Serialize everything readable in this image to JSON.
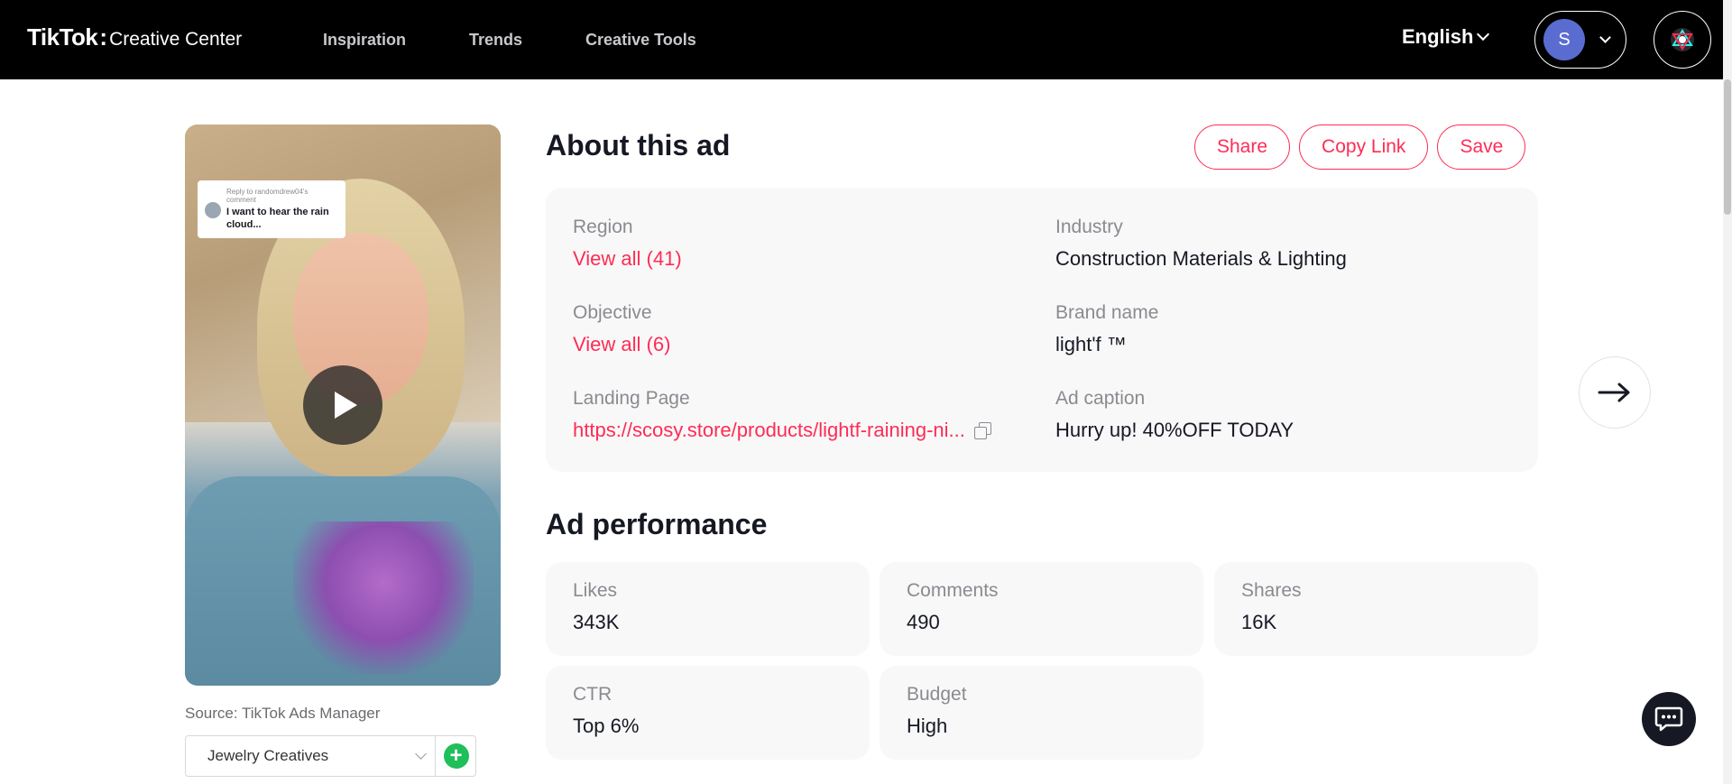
{
  "header": {
    "brand": "TikTok",
    "separator": ":",
    "product": "Creative Center",
    "nav": [
      "Inspiration",
      "Trends",
      "Creative Tools"
    ],
    "language": "English",
    "avatar_initial": "S"
  },
  "video": {
    "comment_reply": "Reply to randomdrew04's comment",
    "comment_text": "I want to hear the rain cloud..."
  },
  "source_label": "Source: TikTok Ads Manager",
  "collection": {
    "selected": "Jewelry Creatives",
    "add_symbol": "+"
  },
  "about": {
    "title": "About this ad",
    "actions": {
      "share": "Share",
      "copy_link": "Copy Link",
      "save": "Save"
    },
    "fields": {
      "region": {
        "label": "Region",
        "value": "View all (41)"
      },
      "industry": {
        "label": "Industry",
        "value": "Construction Materials & Lighting"
      },
      "objective": {
        "label": "Objective",
        "value": "View all (6)"
      },
      "brand_name": {
        "label": "Brand name",
        "value": "light'f ™"
      },
      "landing_page": {
        "label": "Landing Page",
        "value": "https://scosy.store/products/lightf-raining-ni..."
      },
      "ad_caption": {
        "label": "Ad caption",
        "value": "Hurry up! 40%OFF TODAY"
      }
    }
  },
  "performance": {
    "title": "Ad performance",
    "metrics": {
      "likes": {
        "label": "Likes",
        "value": "343K"
      },
      "comments": {
        "label": "Comments",
        "value": "490"
      },
      "shares": {
        "label": "Shares",
        "value": "16K"
      },
      "ctr": {
        "label": "CTR",
        "value": "Top 6%"
      },
      "budget": {
        "label": "Budget",
        "value": "High"
      }
    }
  },
  "colors": {
    "accent": "#fe2c55",
    "header_bg": "#000000",
    "card_bg": "#f8f8f8",
    "avatar_bg": "#5b6cd1",
    "add_button": "#1fbf5a"
  },
  "icons": {
    "play": "play-icon",
    "next": "arrow-right-icon",
    "chat": "chat-icon",
    "copy": "copy-icon",
    "add": "plus-icon"
  }
}
